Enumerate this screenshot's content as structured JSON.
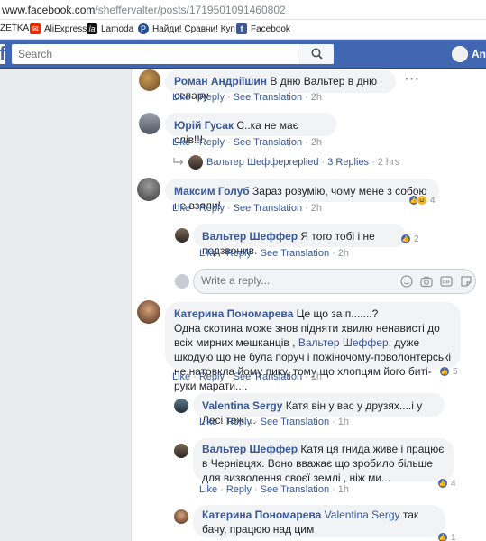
{
  "browser": {
    "url_host": "www.facebook.com",
    "url_path": "/sheffervalter/posts/1719501091460802"
  },
  "bookmarks": [
    {
      "label": "ZETKA",
      "icon": "none"
    },
    {
      "label": "AliExpress",
      "icon": "aliexpress-icon",
      "color": "#e62e04"
    },
    {
      "label": "Lamoda",
      "icon": "lamoda-icon",
      "color": "#111111"
    },
    {
      "label": "Найди! Сравни! Куп",
      "icon": "price-icon",
      "color": "#1f4e9b"
    },
    {
      "label": "Facebook",
      "icon": "facebook-icon",
      "color": "#3b5998"
    }
  ],
  "fb_header": {
    "search_placeholder": "Search",
    "user_name": "And"
  },
  "actions": {
    "like": "Like",
    "reply": "Reply",
    "see_translation": "See Translation",
    "dot": "·"
  },
  "comments": [
    {
      "author": "Роман Андріїшин",
      "text": " В дню Вальтер в дню сепару",
      "time": "2h"
    },
    {
      "author": "Юрій Гусак",
      "text": " С..ка не має слів!!!",
      "time": "2h"
    },
    {
      "replies_author": "Вальтер Шеффер",
      "replies_text": " replied",
      "replies_count": "3 Replies",
      "replies_time": "2 hrs"
    },
    {
      "author": "Максим Голуб",
      "text": " Зараз розумію, чому мене з собою не взяли!",
      "time": "2h",
      "reactions": "4"
    },
    {
      "author": "Вальтер Шеффер",
      "text": " Я того тобі і не подзвонив.",
      "time": "2h",
      "reactions": "2"
    },
    {
      "author": "Катерина Пономарева",
      "text_line1": " Це що за п.......?",
      "text_rest_a": "Одна скотина може знов підняти хвилю ненависті до всіх мирних мешканців , ",
      "mention": "Вальтер Шеффер",
      "text_rest_b": ", дуже шкодую що не була поруч і пожіночому-поволонтерські не натовкла йому пику, тому що хлопцям його биті-руки марати....",
      "time": "1h",
      "reactions": "5"
    },
    {
      "author": "Valentina Sergy",
      "text": " Катя він у вас у друзях....і у Лесі теж....",
      "time": "1h"
    },
    {
      "author": "Вальтер Шеффер",
      "text": " Катя ця гнида живе і працює в Чернівцях. Воно вважає що зробило більше для визволення своєї землі , ніж ми...",
      "time": "1h",
      "reactions": "4"
    },
    {
      "author": "Катерина Пономарева",
      "mention": "Valentina Sergy",
      "text": " так бачу, працюю над цим",
      "reactions": "1"
    }
  ],
  "write_reply": {
    "placeholder": "Write a reply..."
  }
}
